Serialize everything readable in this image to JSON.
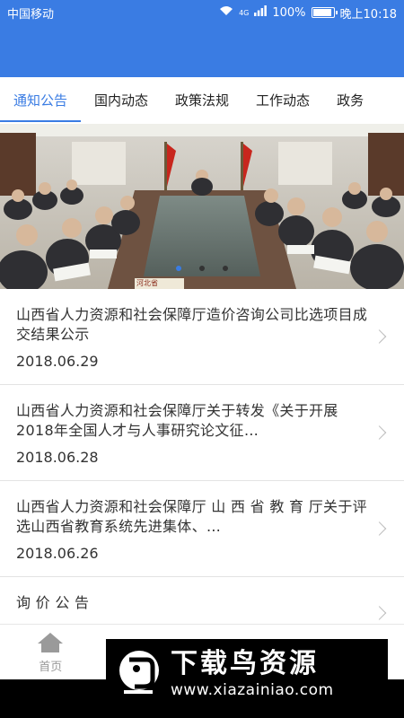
{
  "status_bar": {
    "carrier": "中国移动",
    "network": "4G",
    "battery": "100%",
    "battery_level": 1.0,
    "time": "晚上10:18"
  },
  "tabs": [
    {
      "label": "通知公告",
      "active": true
    },
    {
      "label": "国内动态",
      "active": false
    },
    {
      "label": "政策法规",
      "active": false
    },
    {
      "label": "工作动态",
      "active": false
    },
    {
      "label": "政务",
      "active": false
    }
  ],
  "banner": {
    "slide_count": 3,
    "active_slide": 1,
    "nameplate": "河北省"
  },
  "news": [
    {
      "title": "山西省人力资源和社会保障厅造价咨询公司比选项目成交结果公示",
      "date": "2018.06.29"
    },
    {
      "title": "山西省人力资源和社会保障厅关于转发《关于开展2018年全国人才与人事研究论文征…",
      "date": "2018.06.28"
    },
    {
      "title": "山西省人力资源和社会保障厅 山 西 省 教 育 厅关于评选山西省教育系统先进集体、…",
      "date": "2018.06.26"
    },
    {
      "title": "询 价 公 告",
      "date": ""
    }
  ],
  "bottom_nav": [
    {
      "label": "首页",
      "icon": "home-icon"
    },
    {
      "label": "",
      "icon": "grid-icon"
    },
    {
      "label": "",
      "icon": "compass-icon"
    },
    {
      "label": "",
      "icon": "user-icon"
    }
  ],
  "watermark": {
    "title": "下载鸟资源",
    "url": "www.xiazainiao.com"
  },
  "colors": {
    "primary": "#3a7ce3",
    "text": "#333333",
    "inactive": "#999999"
  }
}
